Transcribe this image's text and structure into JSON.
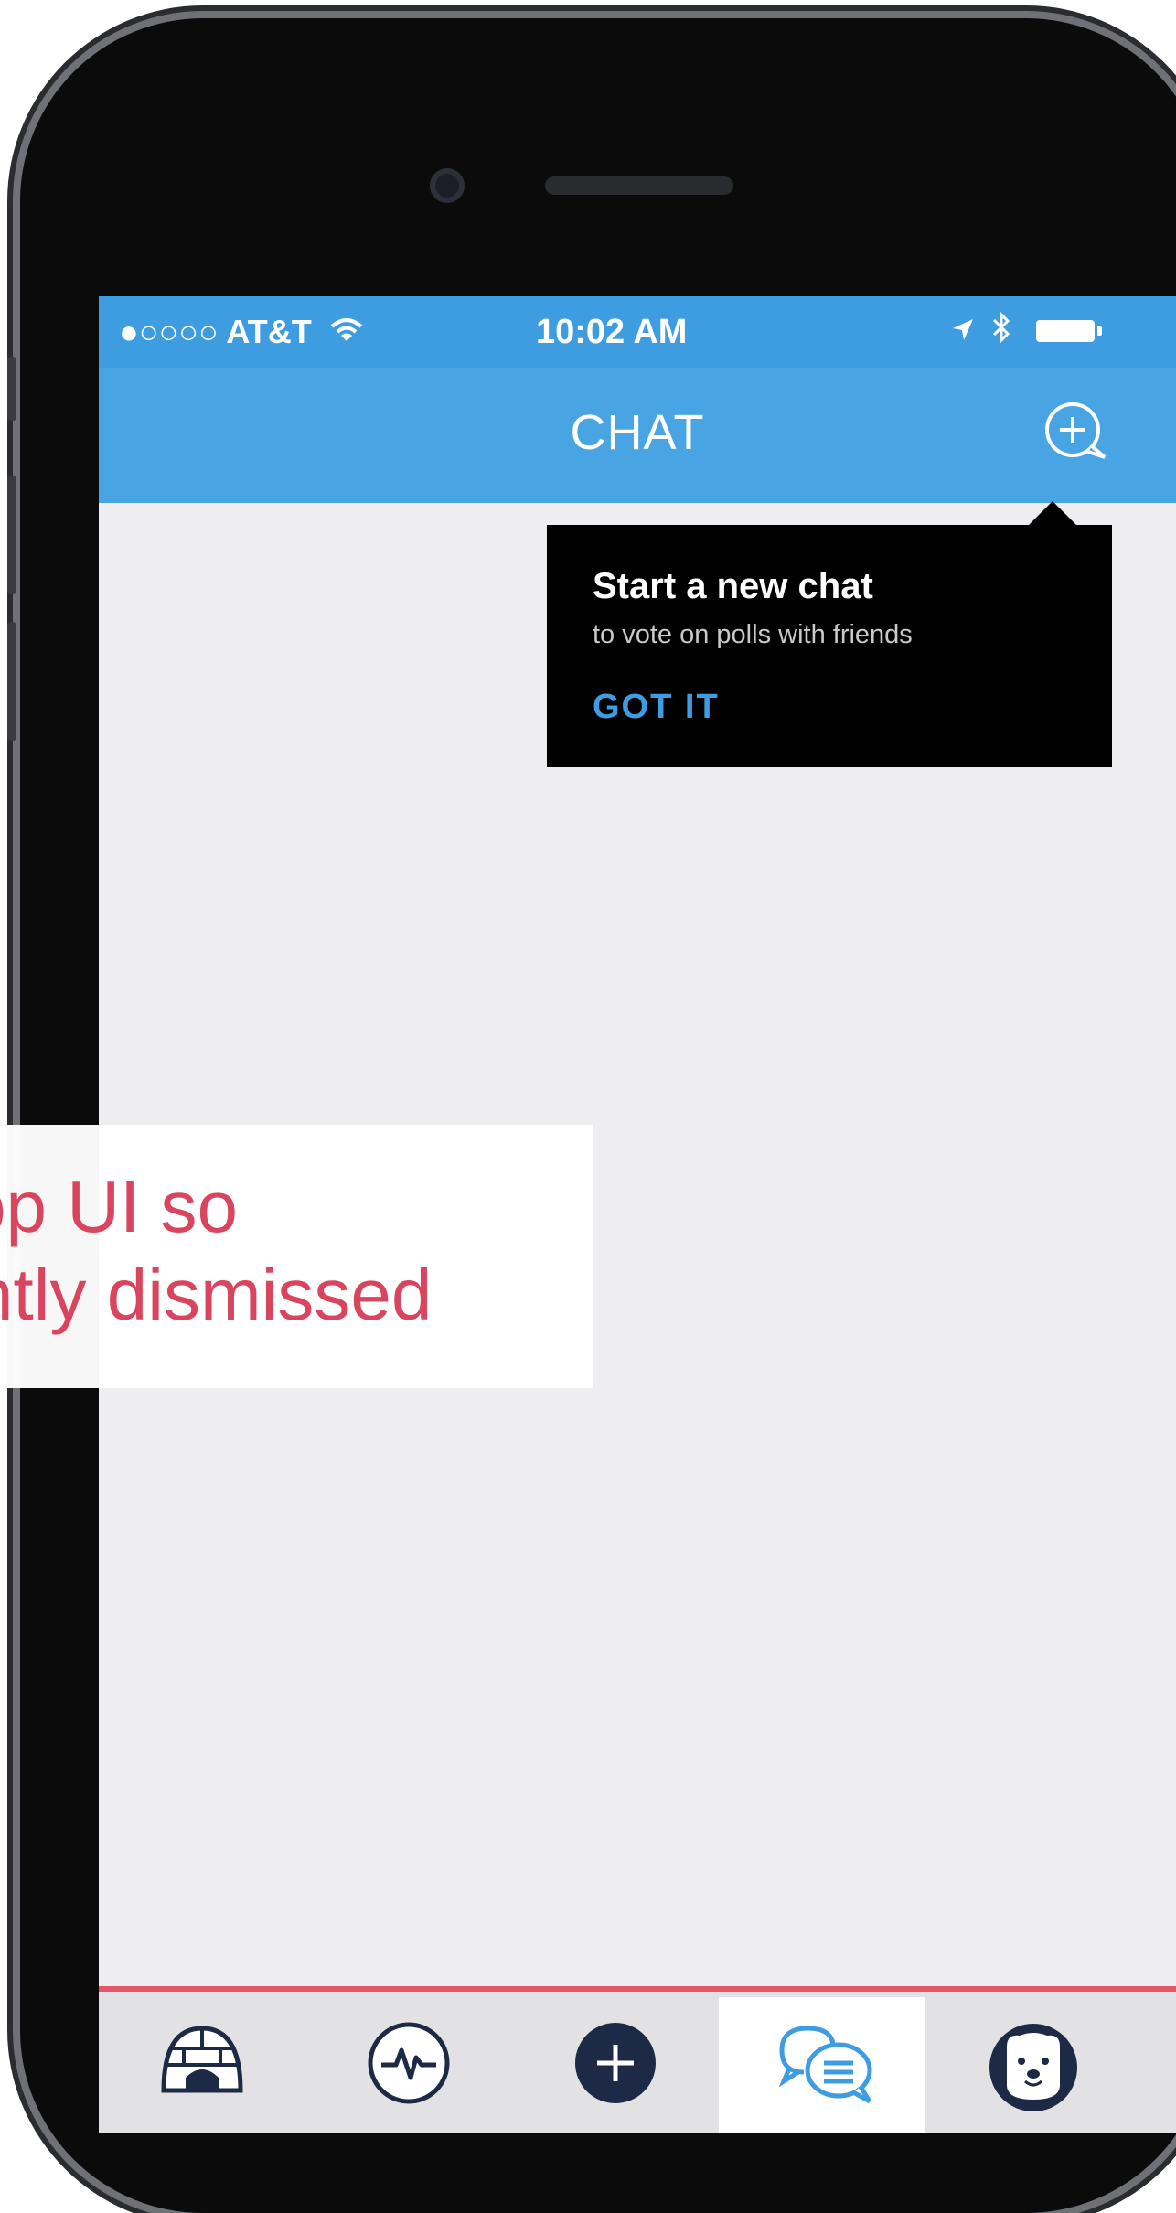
{
  "status_bar": {
    "carrier": "●○○○○ AT&T",
    "time": "10:02 AM"
  },
  "nav": {
    "title": "CHAT"
  },
  "tooltip": {
    "title": "Start a new chat",
    "subtitle": "to vote on polls with friends",
    "action": "GOT IT"
  },
  "overlay": {
    "line1": "pp UI so",
    "line2": "ntly dismissed"
  },
  "tabs": [
    {
      "icon": "igloo-icon",
      "active": false
    },
    {
      "icon": "activity-icon",
      "active": false
    },
    {
      "icon": "plus-icon",
      "active": false
    },
    {
      "icon": "chat-bubbles-icon",
      "active": true
    },
    {
      "icon": "bear-icon",
      "active": false
    }
  ],
  "colors": {
    "nav_blue": "#48a4e2",
    "accent_red": "#e5566b",
    "tooltip_link": "#3d9de0"
  }
}
